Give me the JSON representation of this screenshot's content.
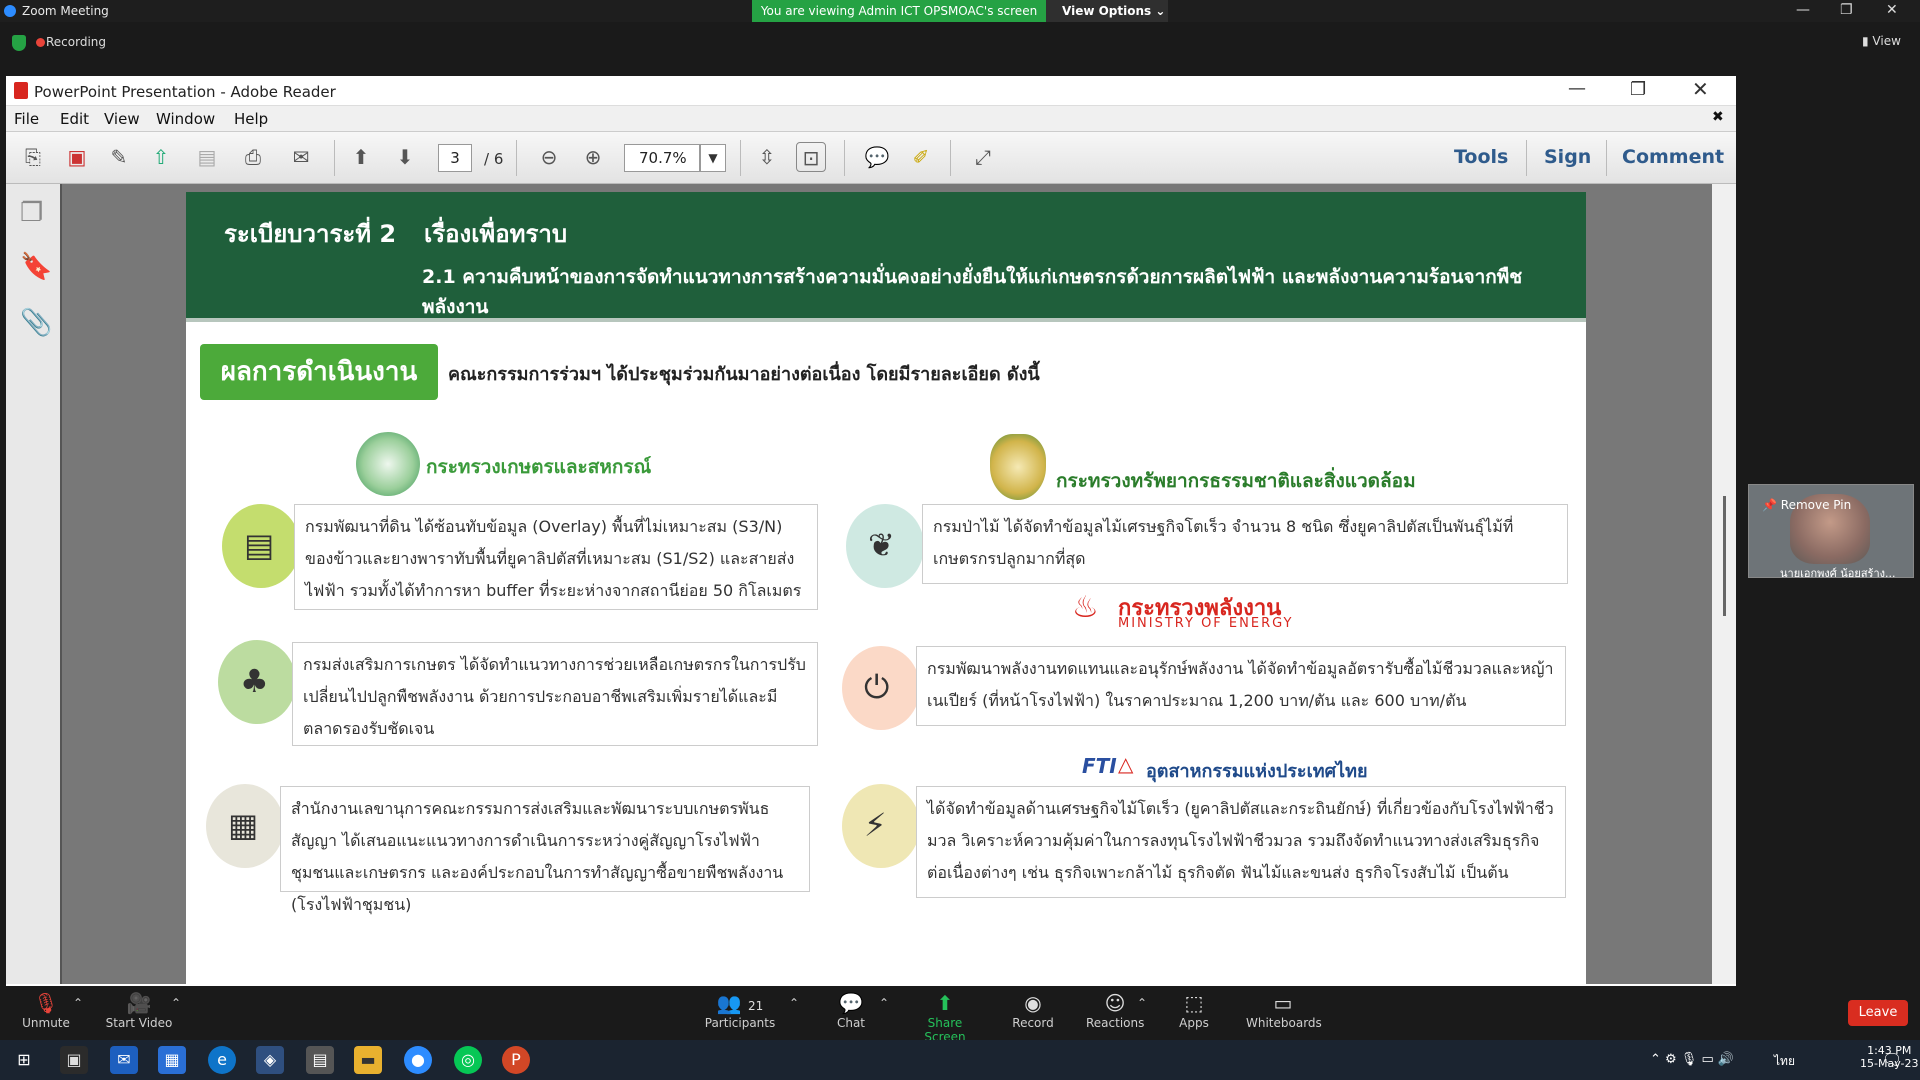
{
  "zoom": {
    "window_title": "Zoom Meeting",
    "share_banner": "You are viewing Admin ICT OPSMOAC's screen",
    "view_options": "View Options",
    "recording": "Recording",
    "view": "View",
    "toolbar": {
      "unmute": "Unmute",
      "start_video": "Start Video",
      "participants": "Participants",
      "participants_count": "21",
      "chat": "Chat",
      "share_screen": "Share Screen",
      "record": "Record",
      "reactions": "Reactions",
      "apps": "Apps",
      "whiteboards": "Whiteboards",
      "leave": "Leave"
    },
    "gallery": {
      "remove_pin": "Remove Pin",
      "name": "นายเอกพงศ์ น้อยสร้าง..."
    }
  },
  "reader": {
    "title": "PowerPoint Presentation - Adobe Reader",
    "menu": [
      "File",
      "Edit",
      "View",
      "Window",
      "Help"
    ],
    "page_current": "3",
    "page_total": "/ 6",
    "zoom": "70.7%",
    "right_tools": [
      "Tools",
      "Sign",
      "Comment"
    ]
  },
  "slide": {
    "agenda_label": "ระเบียบวาระที่ 2",
    "agenda_topic": "เรื่องเพื่อทราบ",
    "subtitle": "2.1 ความคืบหน้าของการจัดทำแนวทางการสร้างความมั่นคงอย่างยั่งยืนให้แก่เกษตรกรด้วยการผลิตไฟฟ้า และพลังงานความร้อนจากพืชพลังงาน",
    "result_label": "ผลการดำเนินงาน",
    "result_desc": "คณะกรรมการร่วมฯ ได้ประชุมร่วมกันมาอย่างต่อเนื่อง โดยมีรายละเอียด ดังนี้",
    "ministry_agri": "กระทรวงเกษตรและสหกรณ์",
    "ministry_nre": "กระทรวงทรัพยากรธรรมชาติและสิ่งแวดล้อม",
    "ministry_energy_th": "กระทรวงพลังงาน",
    "ministry_energy_en": "MINISTRY OF ENERGY",
    "fti": "FTI",
    "fti_name": "อุตสาหกรรมแห่งประเทศไทย",
    "cards": {
      "ldd": "กรมพัฒนาที่ดิน ได้ซ้อนทับข้อมูล (Overlay) พื้นที่ไม่เหมาะสม (S3/N) ของข้าวและยางพาราทับพื้นที่ยูคาลิปตัสที่เหมาะสม (S1/S2) และสายส่งไฟฟ้า รวมทั้งได้ทำการหา buffer ที่ระยะห่างจากสถานีย่อย 50 กิโลเมตร",
      "doae": "กรมส่งเสริมการเกษตร ได้จัดทำแนวทางการช่วยเหลือเกษตรกรในการปรับเปลี่ยนไปปลูกพืชพลังงาน ด้วยการประกอบอาชีพเสริมเพิ่มรายได้และมีตลาดรองรับชัดเจน",
      "opsmoac": "สำนักงานเลขานุการคณะกรรมการส่งเสริมและพัฒนาระบบเกษตรพันธสัญญา ได้เสนอแนะแนวทางการดำเนินการระหว่างคู่สัญญาโรงไฟฟ้าชุมชนและเกษตรกร และองค์ประกอบในการทำสัญญาซื้อขายพืชพลังงาน (โรงไฟฟ้าชุมชน)",
      "rfd": "กรมป่าไม้ ได้จัดทำข้อมูลไม้เศรษฐกิจโตเร็ว จำนวน 8 ชนิด ซึ่งยูคาลิปตัสเป็นพันธุ์ไม้ที่เกษตรกรปลูกมากที่สุด",
      "dede": "กรมพัฒนาพลังงานทดแทนและอนุรักษ์พลังงาน ได้จัดทำข้อมูลอัตรารับซื้อไม้ชีวมวลและหญ้าเนเปียร์ (ที่หน้าโรงไฟฟ้า) ในราคาประมาณ 1,200 บาท/ตัน และ 600 บาท/ตัน",
      "fti": "ได้จัดทำข้อมูลด้านเศรษฐกิจไม้โตเร็ว (ยูคาลิปตัสและกระถินยักษ์) ที่เกี่ยวข้องกับโรงไฟฟ้าชีวมวล วิเคราะห์ความคุ้มค่าในการลงทุนโรงไฟฟ้าชีวมวล รวมถึงจัดทำแนวทางส่งเสริมธุรกิจต่อเนื่องต่างๆ เช่น ธุรกิจเพาะกล้าไม้ ธุรกิจตัด ฟันไม้และขนส่ง ธุรกิจโรงสับไม้ เป็นต้น"
    }
  },
  "taskbar": {
    "time": "1:43 PM",
    "date": "15-May-23",
    "lang": "ไทย"
  },
  "colors": {
    "header_green": "#1f5f3b",
    "result_green": "#4caa3a",
    "zoom_green": "#25a244",
    "leave_red": "#d92d20"
  }
}
